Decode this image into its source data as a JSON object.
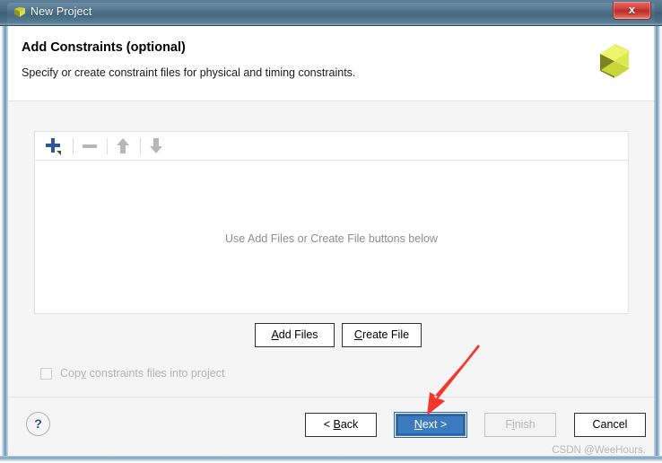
{
  "window": {
    "title": "New Project",
    "app_icon": "vivado-leaf-icon",
    "close_label": "x"
  },
  "header": {
    "title": "Add Constraints (optional)",
    "subtitle": "Specify or create constraint files for physical and timing constraints.",
    "logo": "vivado-pinwheel-logo"
  },
  "toolbar": {
    "buttons": [
      {
        "name": "add-icon",
        "glyph": "+",
        "enabled": true,
        "color": "#2f5597"
      },
      {
        "name": "remove-icon",
        "glyph": "−",
        "enabled": false,
        "color": "#b4b4b4"
      },
      {
        "name": "move-up-icon",
        "glyph": "⬆",
        "enabled": false,
        "color": "#b4b4b4"
      },
      {
        "name": "move-down-icon",
        "glyph": "⬇",
        "enabled": false,
        "color": "#b4b4b4"
      }
    ]
  },
  "file_list": {
    "empty_message": "Use Add Files or Create File buttons below",
    "rows": []
  },
  "file_actions": {
    "add_files": {
      "label": "Add Files",
      "accel": "A"
    },
    "create_file": {
      "label": "Create File",
      "accel": "C"
    }
  },
  "copy_option": {
    "label": "Copy constraints files into project",
    "checked": false,
    "enabled": false
  },
  "footer": {
    "help_label": "?",
    "buttons": [
      {
        "name": "back-button",
        "label": "< Back",
        "state": "normal"
      },
      {
        "name": "next-button",
        "label": "Next >",
        "state": "default-focused"
      },
      {
        "name": "finish-button",
        "label": "Finish",
        "state": "disabled"
      },
      {
        "name": "cancel-button",
        "label": "Cancel",
        "state": "normal"
      }
    ]
  },
  "annotation": {
    "arrow_color": "#f4362e",
    "points_to": "next-button"
  },
  "watermark": {
    "text": "CSDN @WeeHours."
  },
  "colors": {
    "titlebar": "#4d7087",
    "accent_blue": "#3c7ac0",
    "panel_bg": "#f5f5f5",
    "logo_green": "#c8d633",
    "logo_olive": "#7b8420"
  }
}
